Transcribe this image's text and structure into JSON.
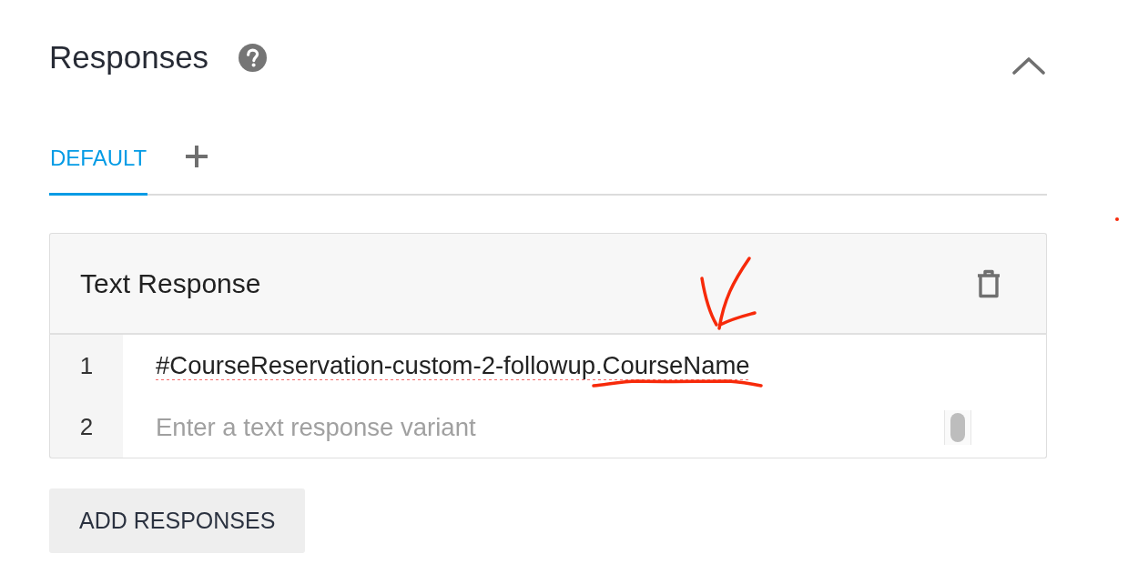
{
  "section": {
    "title": "Responses",
    "expanded": true
  },
  "tabs": [
    {
      "label": "DEFAULT",
      "selected": true
    }
  ],
  "card": {
    "title": "Text Response",
    "rows": [
      {
        "number": "1",
        "value": "#CourseReservation-custom-2-followup.CourseName",
        "misspelled": true
      },
      {
        "number": "2",
        "placeholder": "Enter a text response variant",
        "misspelled": false
      }
    ]
  },
  "add_button": {
    "label": "ADD RESPONSES"
  },
  "annotations": [
    {
      "kind": "arrow"
    },
    {
      "kind": "underline"
    },
    {
      "kind": "dot"
    }
  ]
}
